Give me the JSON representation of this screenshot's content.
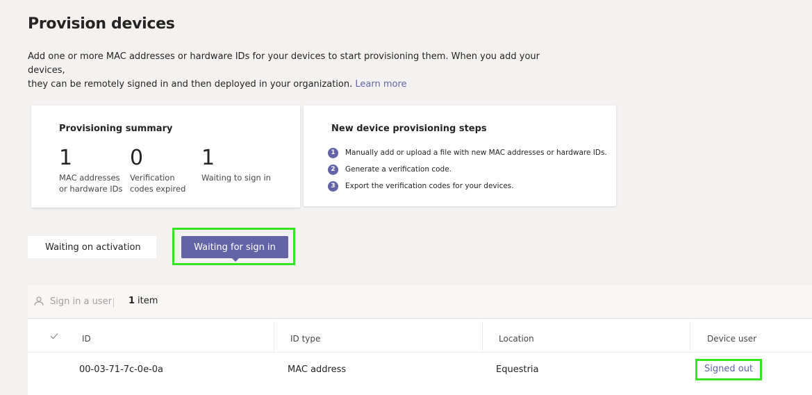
{
  "page": {
    "title": "Provision devices",
    "intro_line1": "Add one or more MAC addresses or hardware IDs for your devices to start provisioning them. When you add your devices,",
    "intro_line2": "they can be remotely signed in and then deployed in your organization.",
    "learn_more": "Learn more"
  },
  "summary": {
    "title": "Provisioning summary",
    "stats": [
      {
        "value": "1",
        "label": "MAC addresses or hardware IDs"
      },
      {
        "value": "0",
        "label": "Verification codes expired"
      },
      {
        "value": "1",
        "label": "Waiting to sign in"
      }
    ]
  },
  "steps": {
    "title": "New device provisioning steps",
    "items": [
      {
        "num": "1",
        "text": "Manually add or upload a file with new MAC addresses or hardware IDs."
      },
      {
        "num": "2",
        "text": "Generate a verification code."
      },
      {
        "num": "3",
        "text": "Export the verification codes for your devices."
      }
    ]
  },
  "tabs": {
    "activation": "Waiting on activation",
    "signin": "Waiting for sign in"
  },
  "toolbar": {
    "sign_in_user": "Sign in a user",
    "count": "1",
    "count_label": "item"
  },
  "table": {
    "headers": [
      "ID",
      "ID type",
      "Location",
      "Device user"
    ],
    "rows": [
      {
        "id": "00-03-71-7c-0e-0a",
        "id_type": "MAC address",
        "location": "Equestria",
        "device_user": "Signed out"
      }
    ]
  },
  "colors": {
    "accent": "#6264a7",
    "highlight": "#35e51d"
  }
}
